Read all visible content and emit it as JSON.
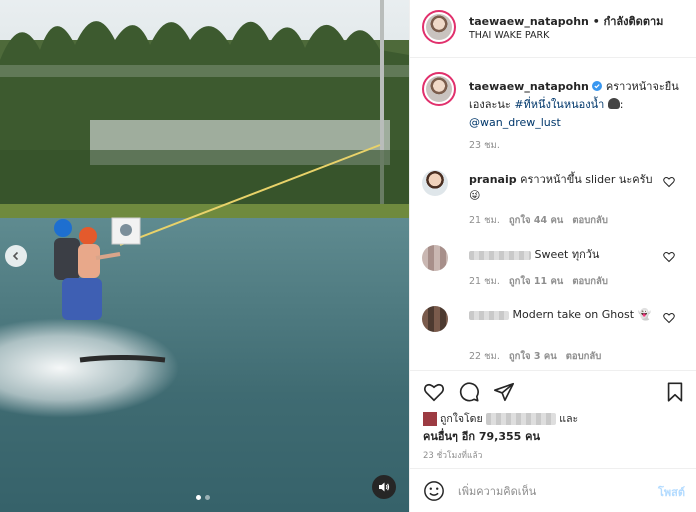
{
  "post": {
    "username": "taewaew_natapohn",
    "follow_separator": " • ",
    "follow_label": "กำลังติดตาม",
    "location": "THAI WAKE PARK"
  },
  "caption": {
    "username": "taewaew_natapohn",
    "text": "คราวหน้าจะยืนเองละนะ",
    "hashtag": "#ที่หนึ่งในหนองน้ำ",
    "suffix": ":",
    "mention": "@wan_drew_lust",
    "time": "23 ชม."
  },
  "comments": [
    {
      "username": "pranaip",
      "text": "คราวหน้าขึ้น slider นะครับ 😜",
      "time": "21 ชม.",
      "likes": "ถูกใจ 44 คน",
      "reply": "ตอบกลับ"
    },
    {
      "username": "",
      "text": "Sweet ทุกวัน",
      "time": "21 ชม.",
      "likes": "ถูกใจ 11 คน",
      "reply": "ตอบกลับ"
    },
    {
      "username": "",
      "text": "Modern take on Ghost 👻",
      "time": "22 ชม.",
      "likes": "ถูกใจ 3 คน",
      "reply": "ตอบกลับ"
    }
  ],
  "likes": {
    "prefix": "ถูกใจโดย",
    "suffix": "และ",
    "others": "คนอื่นๆ อีก 79,355 คน"
  },
  "posted_ago": "23 ชั่วโมงที่แล้ว",
  "comment_box": {
    "placeholder": "เพิ่มความคิดเห็น",
    "post_label": "โพสต์"
  },
  "media": {
    "slide_count": 2,
    "active_slide": 1
  },
  "colors": {
    "link": "#00376b",
    "post_disabled": "#b3dbff",
    "muted": "#8e8e8e"
  },
  "icons": [
    "chevron-left-icon",
    "speaker-icon",
    "heart-icon",
    "comment-icon",
    "share-icon",
    "bookmark-icon",
    "emoji-icon",
    "verified-icon"
  ]
}
